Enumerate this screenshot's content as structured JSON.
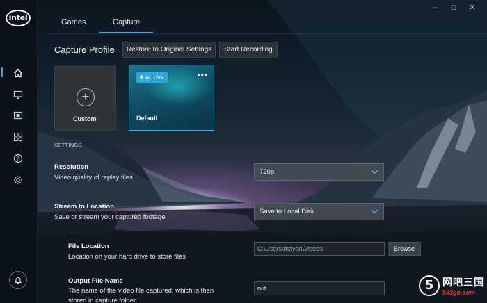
{
  "sidebar": {
    "logo_text": "intel",
    "icons": [
      "home-icon",
      "display-icon",
      "capture-icon",
      "apps-icon",
      "help-icon",
      "settings-icon",
      "notifications-icon"
    ],
    "active": "home-icon",
    "accent": "#38a8e0"
  },
  "window_controls": {
    "minimize": "–",
    "maximize": "☐",
    "close": "✕"
  },
  "tabs": [
    {
      "label": "Games",
      "active": false
    },
    {
      "label": "Capture",
      "active": true
    }
  ],
  "header": {
    "title": "Capture Profile",
    "restore_label": "Restore to Original Settings",
    "record_label": "Start Recording"
  },
  "profiles": [
    {
      "label": "Custom",
      "type": "add"
    },
    {
      "label": "Default",
      "badge": "ACTIVE",
      "badge_color": "#2ba6df",
      "more": "•••"
    }
  ],
  "settings": {
    "section_label": "SETTINGS",
    "resolution": {
      "title": "Resolution",
      "desc": "Video quality of replay files",
      "value": "720p"
    },
    "stream": {
      "title": "Stream to Location",
      "desc": "Save or stream your captured footage",
      "value": "Save to Local Disk"
    },
    "file_location": {
      "title": "File Location",
      "desc": "Location on your hard drive to store files",
      "value": "C:\\Users\\mayan\\Videos",
      "browse_label": "Browse"
    },
    "output_name": {
      "title": "Output File Name",
      "desc_line1": "The name of the video file captured, which is then",
      "desc_line2": "stored in capture folder.",
      "value": "out"
    }
  },
  "watermark": {
    "glyph": "5",
    "cn": "网吧三国",
    "url": "583go.com"
  }
}
